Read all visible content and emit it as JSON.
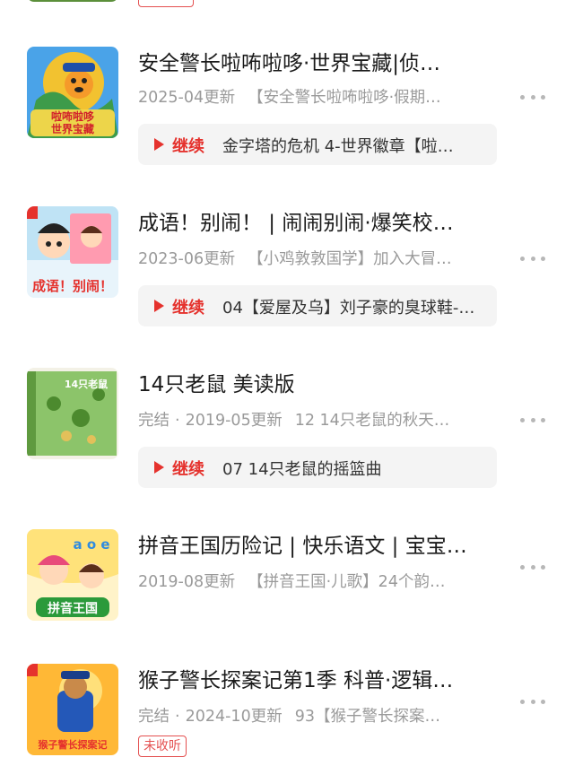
{
  "items": [
    {
      "title": "安全警长啦咘啦哆·世界宝藏|侦…",
      "status": "",
      "updated": "2025-04更新",
      "desc": "【安全警长啦咘啦哆·假期…",
      "resume_label": "继续",
      "resume_episode": "金字塔的危机 4-世界徽章【啦…",
      "cover_text": "啦咘啦哆 世界宝藏",
      "cover_icon": "dog-police-cover"
    },
    {
      "title": "成语！别闹！ | 闹闹别闹·爆笑校…",
      "status": "",
      "updated": "2023-06更新",
      "desc": "【小鸡敦敦国学】加入大冒…",
      "resume_label": "继续",
      "resume_episode": "04【爱屋及乌】刘子豪的臭球鞋-…",
      "cover_text": "成语！别闹！",
      "cover_icon": "kids-cartoon-cover"
    },
    {
      "title": "14只老鼠 美读版",
      "status": "完结",
      "updated": "2019-05更新",
      "desc": "12 14只老鼠的秋天…",
      "resume_label": "继续",
      "resume_episode": "07 14只老鼠的摇篮曲",
      "cover_text": "14只老鼠",
      "cover_icon": "mice-book-cover"
    },
    {
      "title": "拼音王国历险记 | 快乐语文 | 宝宝…",
      "status": "",
      "updated": "2019-08更新",
      "desc": "【拼音王国·儿歌】24个韵…",
      "cover_text": "拼音王国",
      "cover_letters": "a o e",
      "cover_icon": "pinyin-kingdom-cover"
    },
    {
      "title": "猴子警长探案记第1季 科普·逻辑…",
      "status": "完结",
      "updated": "2024-10更新",
      "desc": "93【猴子警长探案…",
      "badge": "未收听",
      "cover_text": "猴子警长探案记",
      "cover_icon": "monkey-police-cover"
    }
  ]
}
